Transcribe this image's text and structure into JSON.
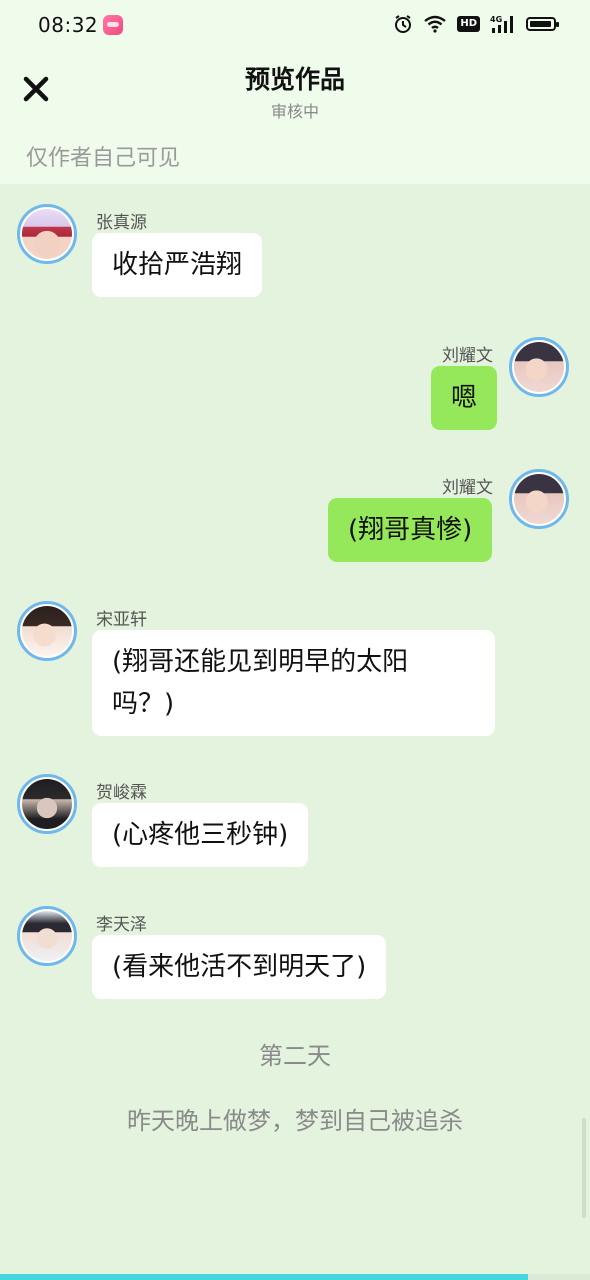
{
  "status_bar": {
    "time": "08:32",
    "network": "4G",
    "hd_label": "HD"
  },
  "header": {
    "title": "预览作品",
    "subtitle": "审核中",
    "visibility_note": "仅作者自己可见"
  },
  "messages": [
    {
      "name": "张真源",
      "text": "收拾严浩翔",
      "side": "left"
    },
    {
      "name": "刘耀文",
      "text": "嗯",
      "side": "right"
    },
    {
      "name": "刘耀文",
      "text": "(翔哥真惨)",
      "side": "right"
    },
    {
      "name": "宋亚轩",
      "text_line1": "(翔哥还能见到明早的太阳",
      "text_line2": "吗？)",
      "side": "left"
    },
    {
      "name": "贺峻霖",
      "text": "(心疼他三秒钟)",
      "side": "left"
    },
    {
      "name": "李天泽",
      "text": "(看来他活不到明天了)",
      "side": "left"
    }
  ],
  "story": {
    "day_marker": "第二天",
    "narration": "昨天晚上做梦，梦到自己被追杀"
  },
  "colors": {
    "accent_blue": "#6fb8ec",
    "bubble_green": "#95e85a",
    "page_bg": "#e4f3de",
    "header_bg": "#effcec",
    "progress": "#43d6dc"
  }
}
